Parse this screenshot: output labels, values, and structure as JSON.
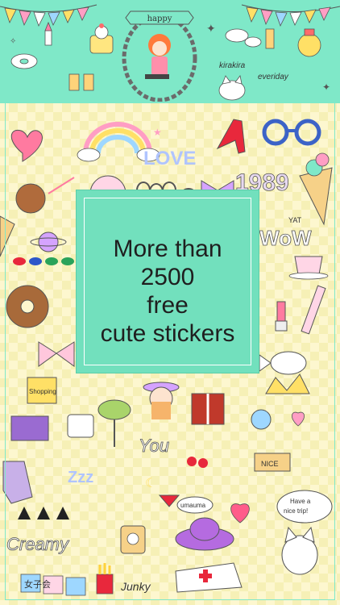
{
  "header": {
    "banner_text": "happy",
    "tag_text_1": "kirakira",
    "tag_text_2": "everiday"
  },
  "promo": {
    "line1": "More than",
    "line2": "2500",
    "line3": "free",
    "line4": "cute stickers"
  },
  "stickers": {
    "love_text": "LOVE",
    "year_text": "1989",
    "wow_text": "WoW",
    "yat_text": "YAT",
    "shopping_text": "Shopping",
    "you_text": "You",
    "zzz_text": "Zzz",
    "umauma_text": "umauma",
    "nice_text": "NICE",
    "trip_text_1": "Have a",
    "trip_text_2": "nice trip!",
    "creamy_text": "Creamy",
    "junky_text": "Junky",
    "joshikai_text": "女子会"
  },
  "colors": {
    "mint": "#7fe8c8",
    "card": "#72e0bd",
    "paper": "#fdf7cf"
  }
}
